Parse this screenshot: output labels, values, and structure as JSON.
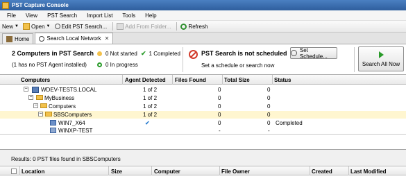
{
  "window": {
    "title": "PST Capture Console"
  },
  "menu": [
    "File",
    "View",
    "PST Search",
    "Import List",
    "Tools",
    "Help"
  ],
  "toolbar": {
    "new": "New",
    "open": "Open",
    "edit_search": "Edit PST Search...",
    "add_from_folder": "Add From Folder...",
    "refresh": "Refresh"
  },
  "tabs": {
    "home": "Home",
    "search": "Search Local Network"
  },
  "status": {
    "summary": "2 Computers in PST Search",
    "agent_note": "(1 has no PST Agent installed)",
    "not_started": "0 Not started",
    "completed": "1 Completed",
    "in_progress": "0 In progress",
    "schedule_title": "PST Search is not scheduled",
    "schedule_sub": "Set a schedule or search now",
    "set_schedule": "Set Schedule...",
    "search_all": "Search All Now"
  },
  "tree_columns": [
    "Computers",
    "Agent Detected",
    "Files Found",
    "Total Size",
    "Status"
  ],
  "tree_rows": [
    {
      "name": "WDEV-TESTS.LOCAL",
      "agent": "1 of 2",
      "files": "0",
      "size": "0",
      "status": ""
    },
    {
      "name": "MyBusiness",
      "agent": "1 of 2",
      "files": "0",
      "size": "0",
      "status": ""
    },
    {
      "name": "Computers",
      "agent": "1 of 2",
      "files": "0",
      "size": "0",
      "status": ""
    },
    {
      "name": "SBSComputers",
      "agent": "1 of 2",
      "files": "0",
      "size": "0",
      "status": ""
    },
    {
      "name": "WIN7_X64",
      "agent": "✔",
      "files": "0",
      "size": "0",
      "status": "Completed"
    },
    {
      "name": "WINXP-TEST",
      "agent": "",
      "files": "-",
      "size": "-",
      "status": ""
    }
  ],
  "results": "Results: 0 PST files found in SBSComputers",
  "file_columns": [
    "Location",
    "Size",
    "Computer",
    "File Owner",
    "Created",
    "Last Modified"
  ],
  "colors": {
    "accent": "#2f5f9e",
    "completed": "#2a9b2a",
    "not_started": "#f3c14b",
    "error": "#d23b2b",
    "selection": "#fff6d0"
  }
}
